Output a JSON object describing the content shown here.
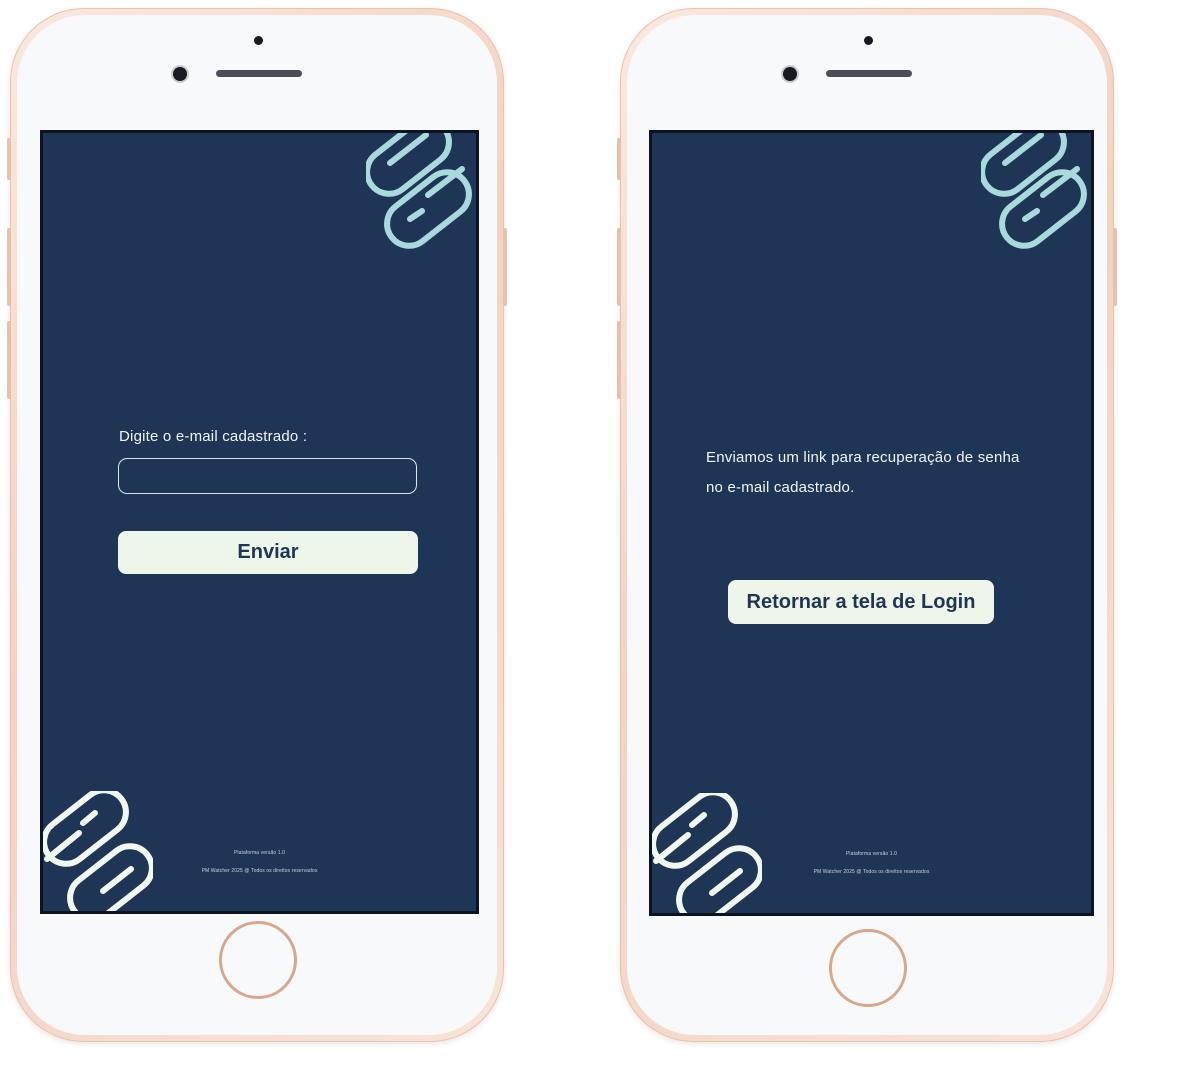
{
  "screens": {
    "forgot_password": {
      "prompt_label": "Digite o e-mail cadastrado :",
      "email_value": "",
      "email_placeholder": "",
      "submit_label": "Enviar",
      "footer_version": "Plataforma versão 1.0",
      "footer_copyright": "PM Watcher 2025 @ Todos os direitos reservados"
    },
    "confirmation": {
      "message_line1": "Enviamos um link para recuperação de senha",
      "message_line2": "no e-mail cadastrado.",
      "return_label": "Retornar a tela de Login",
      "footer_version": "Plataforma versão 1.0",
      "footer_copyright": "PM Watcher 2025 @ Todos os direitos reservados"
    }
  },
  "colors": {
    "screen_background": "#1f3556",
    "button_background": "#eef6ea",
    "button_text": "#1f3556",
    "decoration_top": "#a8dadc",
    "decoration_bottom": "#f1f8ef",
    "phone_frame": "#f3d2c1"
  }
}
